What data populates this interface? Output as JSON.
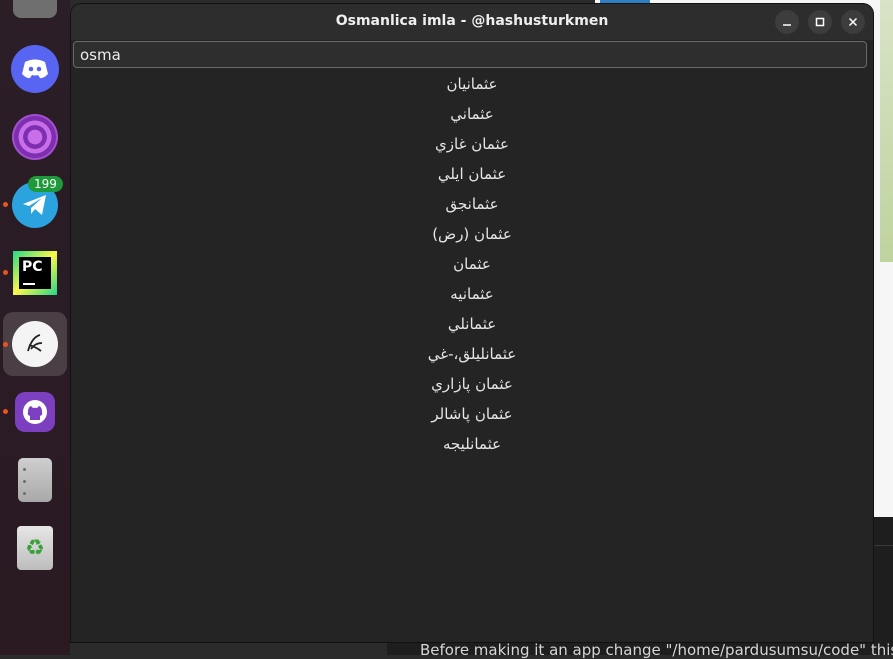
{
  "window": {
    "title": "Osmanlica imla - @hashusturkmen"
  },
  "search": {
    "value": "osma"
  },
  "results": [
    "عثمانيان",
    "عثماني",
    "عثمان غازي",
    "عثمان ايلي",
    "عثمانجق",
    "عثمان (رض)",
    "عثمان",
    "عثمانيه",
    "عثمانلي",
    "عثمانليلق،-غي",
    "عثمان پازاري",
    "عثمان پاشالر",
    "عثمانليجه"
  ],
  "dock": {
    "telegram_badge": "199",
    "pycharm_label": "PC",
    "icons": [
      "app-icon",
      "discord-icon",
      "tor-browser-icon",
      "telegram-icon",
      "pycharm-icon",
      "osmanlica-app-icon",
      "github-desktop-icon",
      "files-icon",
      "trash-icon"
    ]
  },
  "background": {
    "terminal_text": "Before making it an app change \"/home/pardusumsu/code\" this wit"
  },
  "colors": {
    "accent_dot": "#e95420",
    "window_bg": "#242424",
    "discord": "#5865f2",
    "telegram": "#2aa3de",
    "badge": "#1e9a3b"
  }
}
